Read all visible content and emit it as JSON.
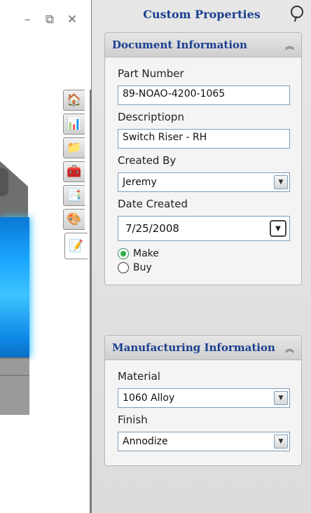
{
  "window_controls": {
    "minimize": "–",
    "restore": "⧉",
    "close": "✕"
  },
  "tabs": [
    {
      "icon": "home-icon",
      "glyph": "🏠"
    },
    {
      "icon": "feature-tree-icon",
      "glyph": "📊"
    },
    {
      "icon": "folder-icon",
      "glyph": "📁"
    },
    {
      "icon": "toolbox-icon",
      "glyph": "🧰"
    },
    {
      "icon": "view-palette-icon",
      "glyph": "📑"
    },
    {
      "icon": "appearances-icon",
      "glyph": "🎨"
    },
    {
      "icon": "custom-properties-icon",
      "glyph": "📝"
    }
  ],
  "panel": {
    "title": "Custom Properties",
    "doc_info": {
      "title": "Document Information",
      "part_number_label": "Part Number",
      "part_number_value": "89-NOAO-4200-1065",
      "description_label": "Descriptiopn",
      "description_value": "Switch Riser - RH",
      "created_by_label": "Created By",
      "created_by_value": "Jeremy",
      "date_created_label": "Date Created",
      "date_created_value": "7/25/2008",
      "make_label": "Make",
      "buy_label": "Buy",
      "make_selected": true
    },
    "mfg_info": {
      "title": "Manufacturing Information",
      "material_label": "Material",
      "material_value": "1060 Alloy",
      "finish_label": "Finish",
      "finish_value": "Annodize"
    }
  }
}
